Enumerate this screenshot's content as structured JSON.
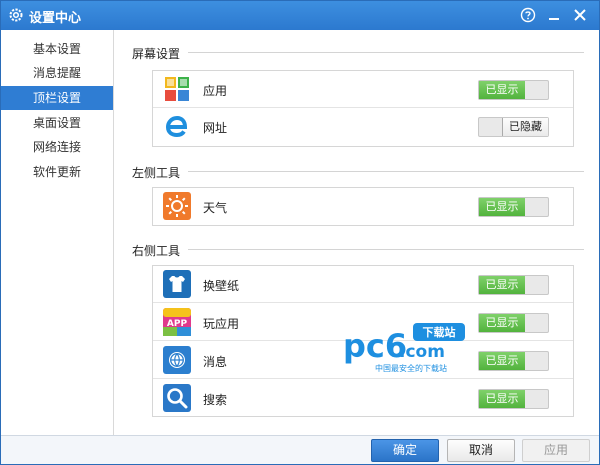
{
  "window": {
    "title": "设置中心"
  },
  "sidebar": {
    "items": [
      {
        "label": "基本设置"
      },
      {
        "label": "消息提醒"
      },
      {
        "label": "顶栏设置"
      },
      {
        "label": "桌面设置"
      },
      {
        "label": "网络连接"
      },
      {
        "label": "软件更新"
      }
    ],
    "active_index": 2
  },
  "sections": [
    {
      "title": "屏幕设置",
      "items": [
        {
          "label": "应用",
          "state": "已显示",
          "icon": "apps-grid-icon"
        },
        {
          "label": "网址",
          "state": "已隐藏",
          "icon": "browser-e-icon"
        }
      ]
    },
    {
      "title": "左侧工具",
      "items": [
        {
          "label": "天气",
          "state": "已显示",
          "icon": "weather-sun-icon"
        }
      ]
    },
    {
      "title": "右侧工具",
      "items": [
        {
          "label": "换壁纸",
          "state": "已显示",
          "icon": "wallpaper-shirt-icon"
        },
        {
          "label": "玩应用",
          "state": "已显示",
          "icon": "app-store-icon"
        },
        {
          "label": "消息",
          "state": "已显示",
          "icon": "news-globe-icon"
        },
        {
          "label": "搜索",
          "state": "已显示",
          "icon": "search-icon"
        }
      ]
    }
  ],
  "footer": {
    "ok_label": "确定",
    "cancel_label": "取消",
    "apply_label": "应用"
  },
  "watermark": {
    "brand_pc": "pc6",
    "brand_com": ".com",
    "badge": "下载站",
    "tagline": "中国最安全的下载站"
  },
  "colors": {
    "titlebar": "#2f7dd3",
    "active_nav": "#2f7dd3",
    "toggle_on": "#5cbc46"
  }
}
